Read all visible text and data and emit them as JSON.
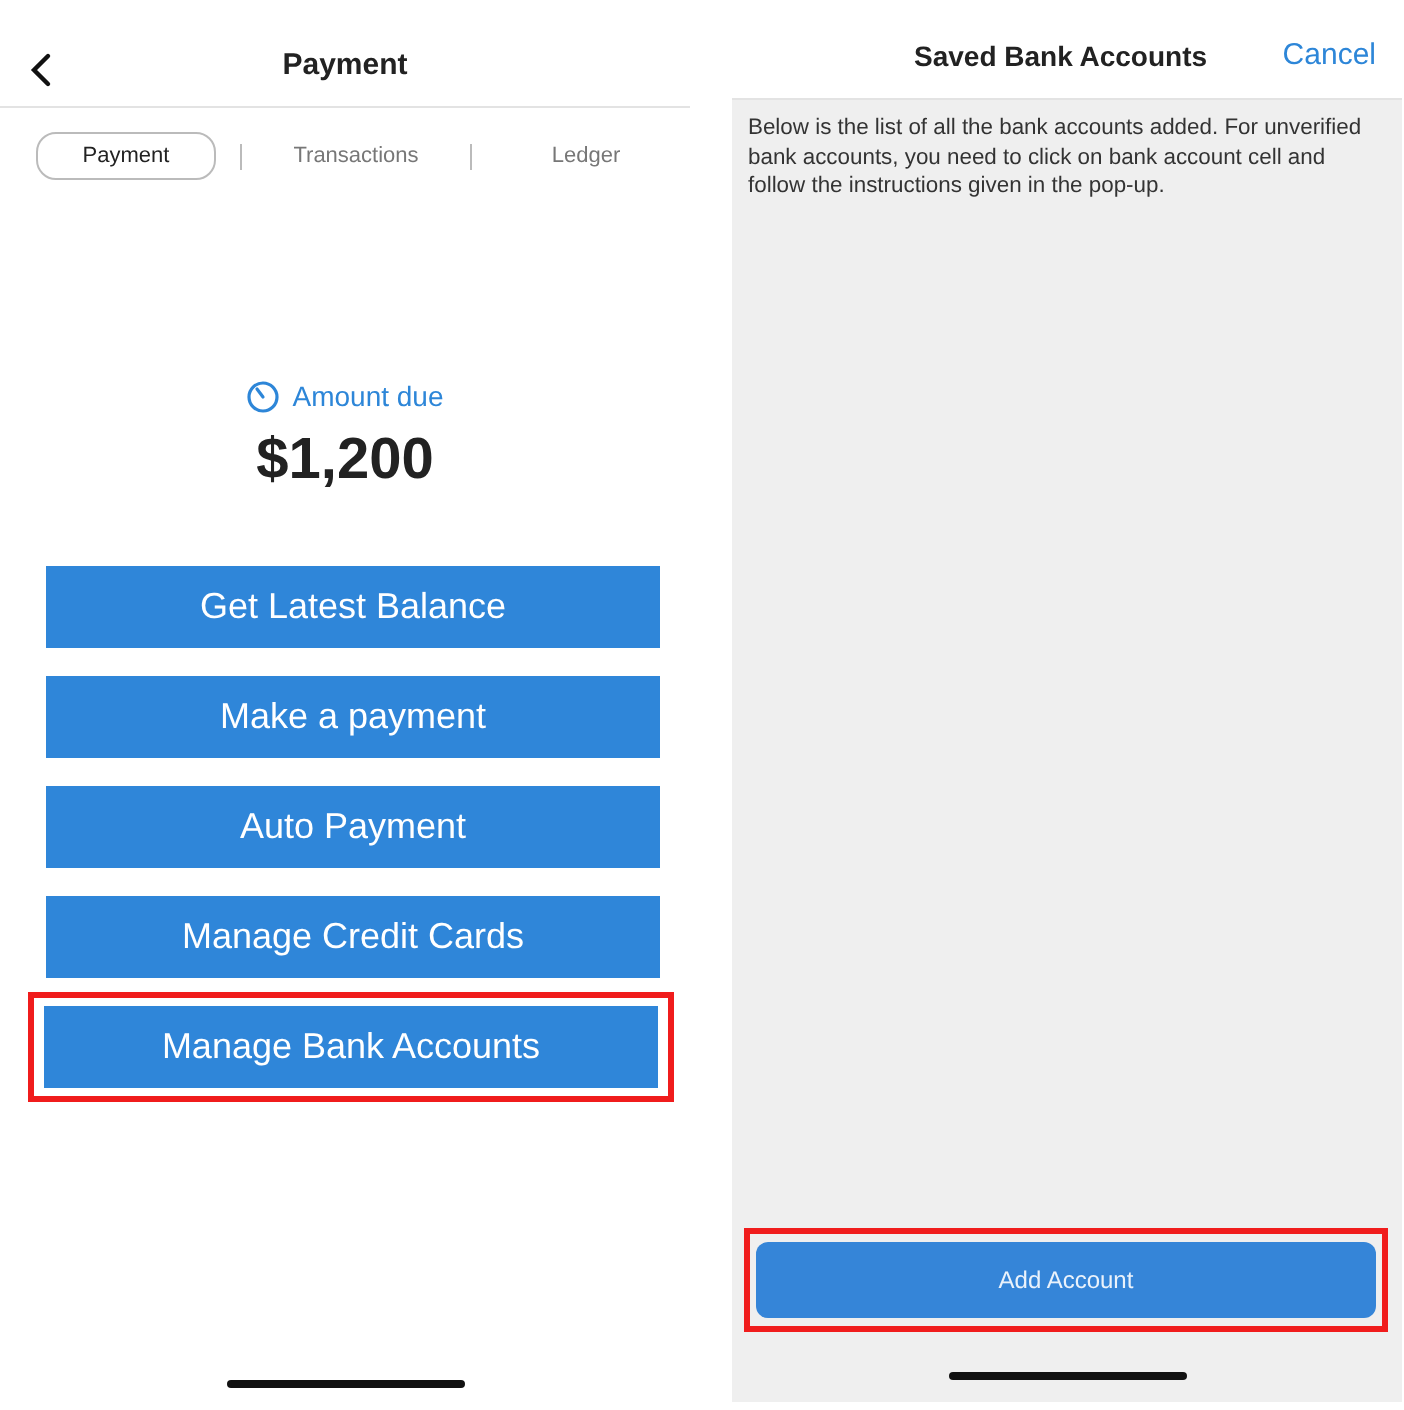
{
  "left_screen": {
    "title": "Payment",
    "tabs": [
      {
        "label": "Payment",
        "selected": true
      },
      {
        "label": "Transactions",
        "selected": false
      },
      {
        "label": "Ledger",
        "selected": false
      }
    ],
    "amount_label": "Amount due",
    "amount": "$1,200",
    "buttons": [
      {
        "label": "Get Latest Balance",
        "highlighted": false
      },
      {
        "label": "Make a payment",
        "highlighted": false
      },
      {
        "label": "Auto Payment",
        "highlighted": false
      },
      {
        "label": "Manage Credit Cards",
        "highlighted": false
      },
      {
        "label": "Manage Bank Accounts",
        "highlighted": true
      }
    ]
  },
  "right_screen": {
    "title": "Saved Bank Accounts",
    "cancel": "Cancel",
    "description": "Below is the list of all the bank accounts added. For unverified bank accounts, you need to click on bank account cell and follow the instructions given in the pop-up.",
    "button": {
      "label": "Add Account",
      "highlighted": true
    }
  }
}
